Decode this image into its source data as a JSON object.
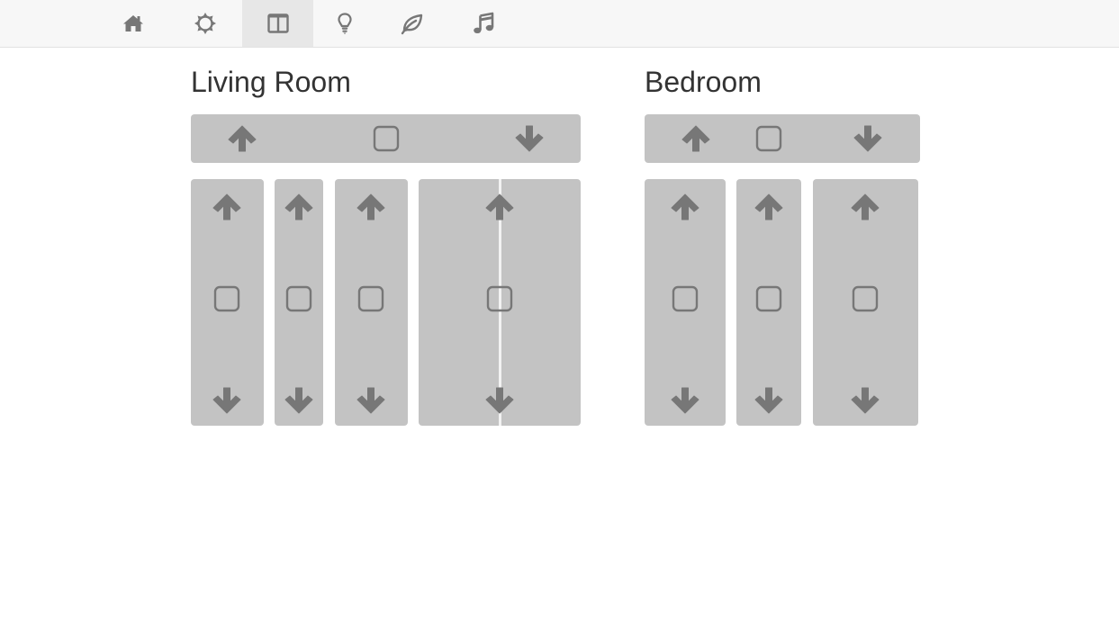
{
  "nav": {
    "items": [
      {
        "name": "home",
        "icon": "home-icon"
      },
      {
        "name": "brightness",
        "icon": "sun-icon"
      },
      {
        "name": "covers",
        "icon": "window-icon",
        "active": true
      },
      {
        "name": "lights",
        "icon": "lightbulb-icon"
      },
      {
        "name": "eco",
        "icon": "leaf-icon"
      },
      {
        "name": "music",
        "icon": "music-note-icon"
      }
    ]
  },
  "rooms": [
    {
      "title": "Living Room",
      "all_covers_group": "up / stop / down",
      "covers_count": 4
    },
    {
      "title": "Bedroom",
      "all_covers_group": "up / stop / down",
      "covers_count": 3
    }
  ],
  "colors": {
    "panel": "#c3c3c3",
    "icon": "#777777",
    "nav_bg": "#f7f7f7",
    "nav_active": "#e7e7e7",
    "title": "#333333"
  }
}
